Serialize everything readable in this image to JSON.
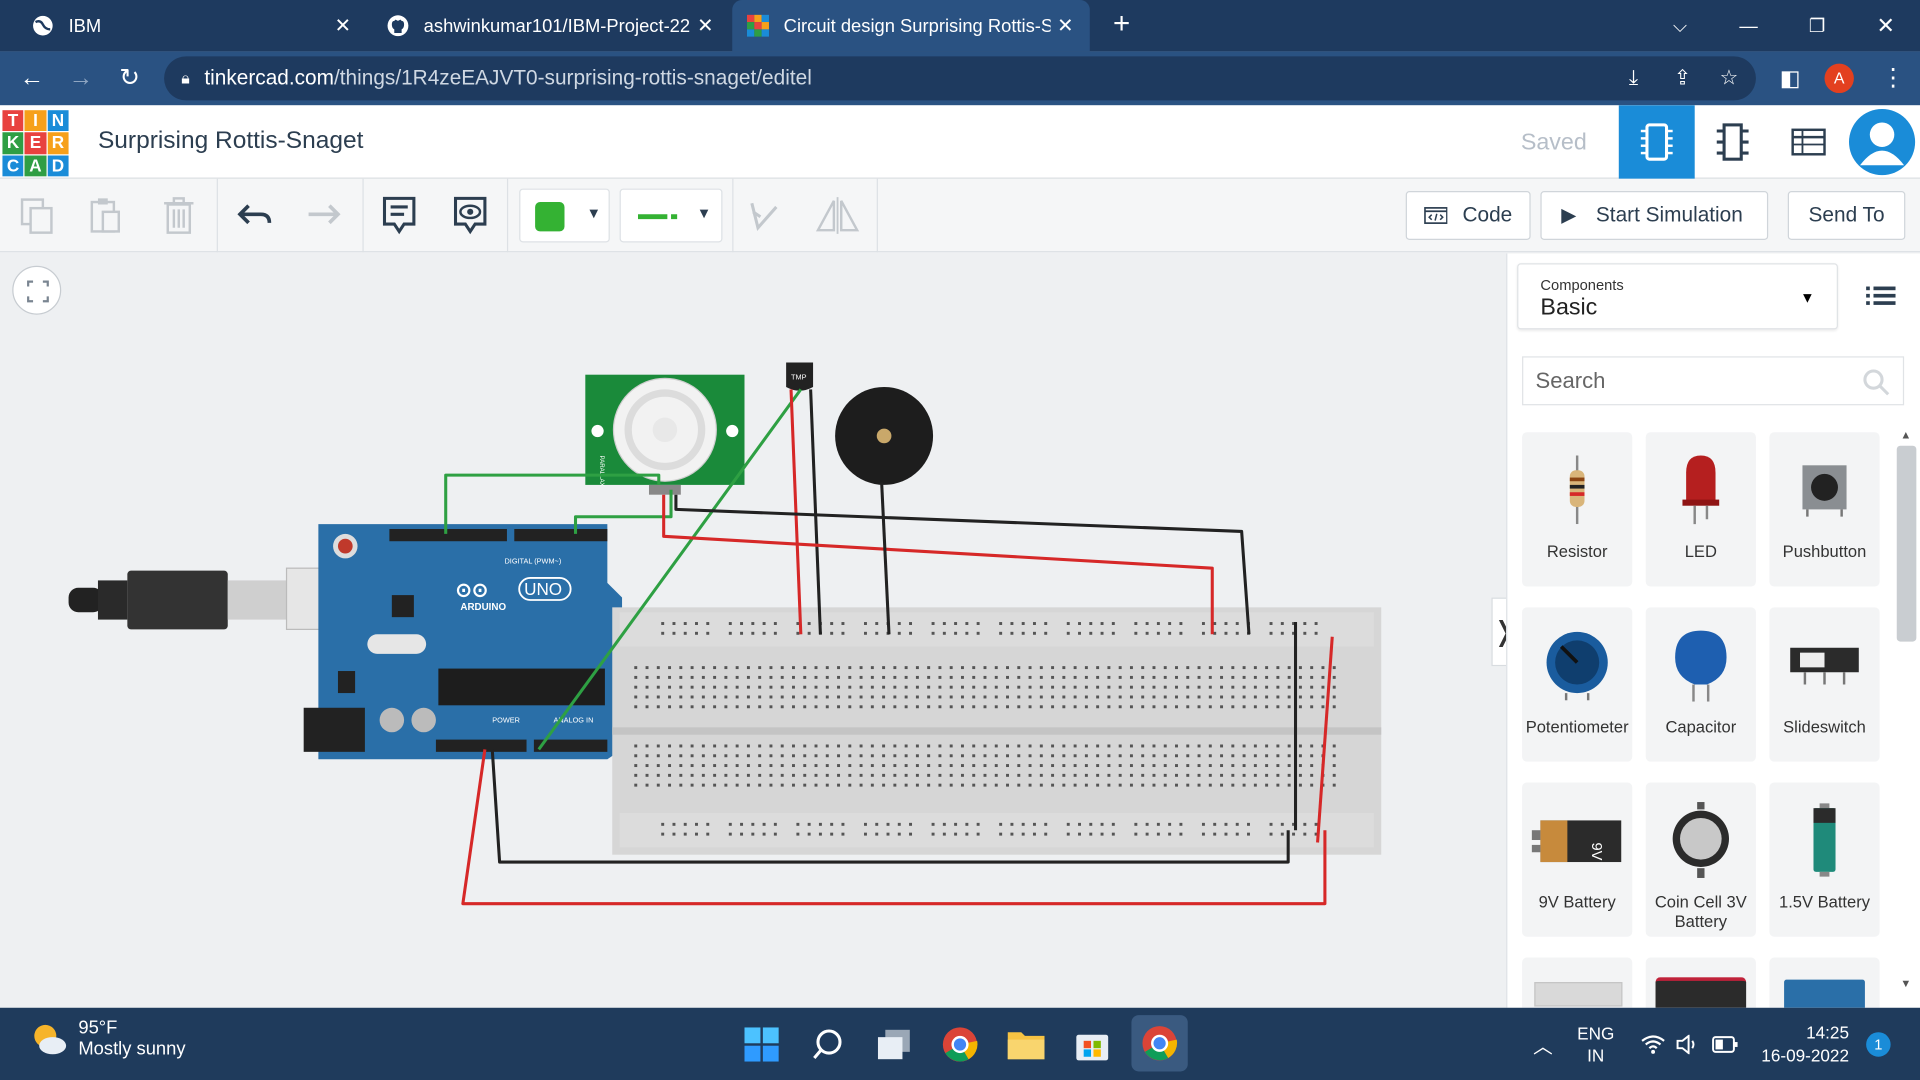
{
  "browser": {
    "tabs": [
      {
        "title": "IBM",
        "icon": "globe-icon",
        "active": false
      },
      {
        "title": "ashwinkumar101/IBM-Project-22",
        "icon": "github-icon",
        "active": false
      },
      {
        "title": "Circuit design Surprising Rottis-S",
        "icon": "tinkercad-icon",
        "active": true
      }
    ],
    "url_host": "tinkercad.com",
    "url_path": "/things/1R4zeEAJVT0-surprising-rottis-snaget/editel",
    "profile_initial": "A"
  },
  "app": {
    "logo_letters": [
      "T",
      "I",
      "N",
      "K",
      "E",
      "R",
      "C",
      "A",
      "D"
    ],
    "logo_colors": [
      "#e8423f",
      "#f6a01a",
      "#1a8cd8",
      "#2f9e44",
      "#e8423f",
      "#f6a01a",
      "#1a8cd8",
      "#2f9e44",
      "#1a8cd8"
    ],
    "design_title": "Surprising Rottis-Snaget",
    "saved_status": "Saved",
    "accent_color": "#1a8cd8"
  },
  "toolbar": {
    "code_label": "Code",
    "start_sim_label": "Start Simulation",
    "send_to_label": "Send To",
    "selected_color": "#34b233"
  },
  "panel": {
    "components_label": "Components",
    "components_value": "Basic",
    "search_placeholder": "Search",
    "items": [
      {
        "name": "Resistor",
        "icon": "resistor-icon"
      },
      {
        "name": "LED",
        "icon": "led-icon"
      },
      {
        "name": "Pushbutton",
        "icon": "pushbutton-icon"
      },
      {
        "name": "Potentiometer",
        "icon": "potentiometer-icon"
      },
      {
        "name": "Capacitor",
        "icon": "capacitor-icon"
      },
      {
        "name": "Slideswitch",
        "icon": "slideswitch-icon"
      },
      {
        "name": "9V Battery",
        "icon": "9v-battery-icon"
      },
      {
        "name": "Coin Cell 3V Battery",
        "icon": "coin-cell-battery-icon"
      },
      {
        "name": "1.5V Battery",
        "icon": "aa-battery-icon"
      }
    ]
  },
  "circuit": {
    "arduino_brand": "UNO",
    "arduino_label": "ARDUINO",
    "arduino_digital_label": "DIGITAL (PWM~)",
    "arduino_power_label": "POWER",
    "arduino_analog_label": "ANALOG IN",
    "tmp_label": "TMP",
    "pir_label": "PARALLAX",
    "wire_colors": {
      "red": "#d62828",
      "black": "#222222",
      "green": "#2ea043"
    }
  },
  "taskbar": {
    "temperature": "95°F",
    "weather_desc": "Mostly sunny",
    "lang_top": "ENG",
    "lang_bottom": "IN",
    "time": "14:25",
    "date": "16-09-2022",
    "notification_count": "1"
  }
}
